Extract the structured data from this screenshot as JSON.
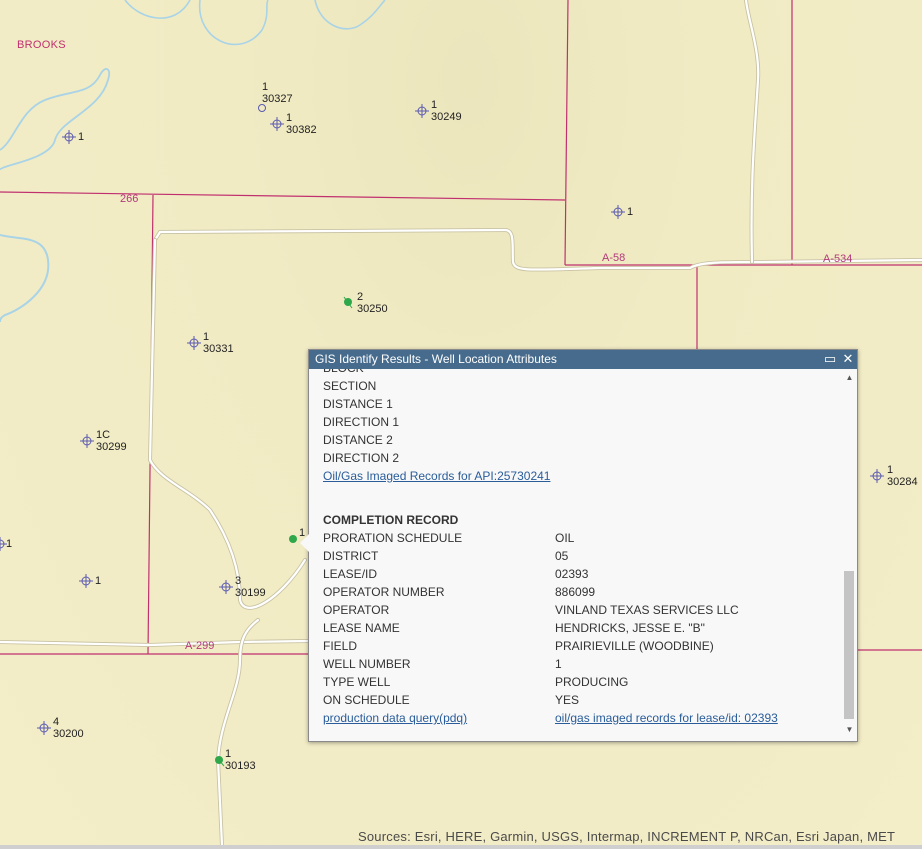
{
  "map": {
    "town_label": "BROOKS",
    "road_labels": {
      "r266": "266",
      "a58": "A-58",
      "a534": "A-534",
      "a299": "A-299"
    },
    "wells": [
      {
        "name": "well-30327",
        "top": "1",
        "bottom": "30327"
      },
      {
        "name": "well-30382",
        "top": "1",
        "bottom": "30382"
      },
      {
        "name": "well-30249",
        "top": "1",
        "bottom": "30249"
      },
      {
        "name": "well-nw",
        "top": "1",
        "bottom": ""
      },
      {
        "name": "well-ne",
        "top": "1",
        "bottom": ""
      },
      {
        "name": "well-30250",
        "top": "2",
        "bottom": "30250"
      },
      {
        "name": "well-30331",
        "top": "1",
        "bottom": "30331"
      },
      {
        "name": "well-30299",
        "top": "1C",
        "bottom": "30299"
      },
      {
        "name": "well-west-edge",
        "top": "1",
        "bottom": ""
      },
      {
        "name": "well-sw",
        "top": "1",
        "bottom": ""
      },
      {
        "name": "well-30199",
        "top": "3",
        "bottom": "30199"
      },
      {
        "name": "well-selected",
        "top": "1",
        "bottom": ""
      },
      {
        "name": "well-30284",
        "top": "1",
        "bottom": "30284"
      },
      {
        "name": "well-30200",
        "top": "4",
        "bottom": "30200"
      },
      {
        "name": "well-30193",
        "top": "1",
        "bottom": "30193"
      }
    ],
    "colors": {
      "survey_line": "#c0306f",
      "road": "#ffffff",
      "water": "#a9d3e6",
      "well_symbol": "#5a5ab0",
      "producing_oil": "#2ea84a"
    }
  },
  "attribution": "Sources: Esri, HERE, Garmin, USGS, Intermap, INCREMENT P, NRCan, Esri Japan, MET",
  "popup": {
    "title": "GIS Identify Results - Well Location Attributes",
    "maximize_icon": "maximize-icon",
    "close_icon": "close-icon",
    "partial_top": "BLOCK",
    "location_fields": [
      "SECTION",
      "DISTANCE 1",
      "DIRECTION 1",
      "DISTANCE 2",
      "DIRECTION 2"
    ],
    "imaged_records_link": "Oil/Gas Imaged Records for API:25730241",
    "completion_header": "COMPLETION RECORD",
    "completion_rows": [
      {
        "label": "PRORATION SCHEDULE",
        "value": "OIL"
      },
      {
        "label": "DISTRICT",
        "value": "05"
      },
      {
        "label": "LEASE/ID",
        "value": "02393"
      },
      {
        "label": "OPERATOR NUMBER",
        "value": "886099"
      },
      {
        "label": "OPERATOR",
        "value": "VINLAND TEXAS SERVICES LLC"
      },
      {
        "label": "LEASE NAME",
        "value": "HENDRICKS, JESSE E. \"B\""
      },
      {
        "label": "FIELD",
        "value": "PRAIRIEVILLE (WOODBINE)"
      },
      {
        "label": "WELL NUMBER",
        "value": "1"
      },
      {
        "label": "TYPE WELL",
        "value": "PRODUCING"
      },
      {
        "label": "ON SCHEDULE",
        "value": "YES"
      }
    ],
    "pdq_link": "production data query(pdq)",
    "lease_records_link": "oil/gas imaged records for lease/id: 02393"
  }
}
